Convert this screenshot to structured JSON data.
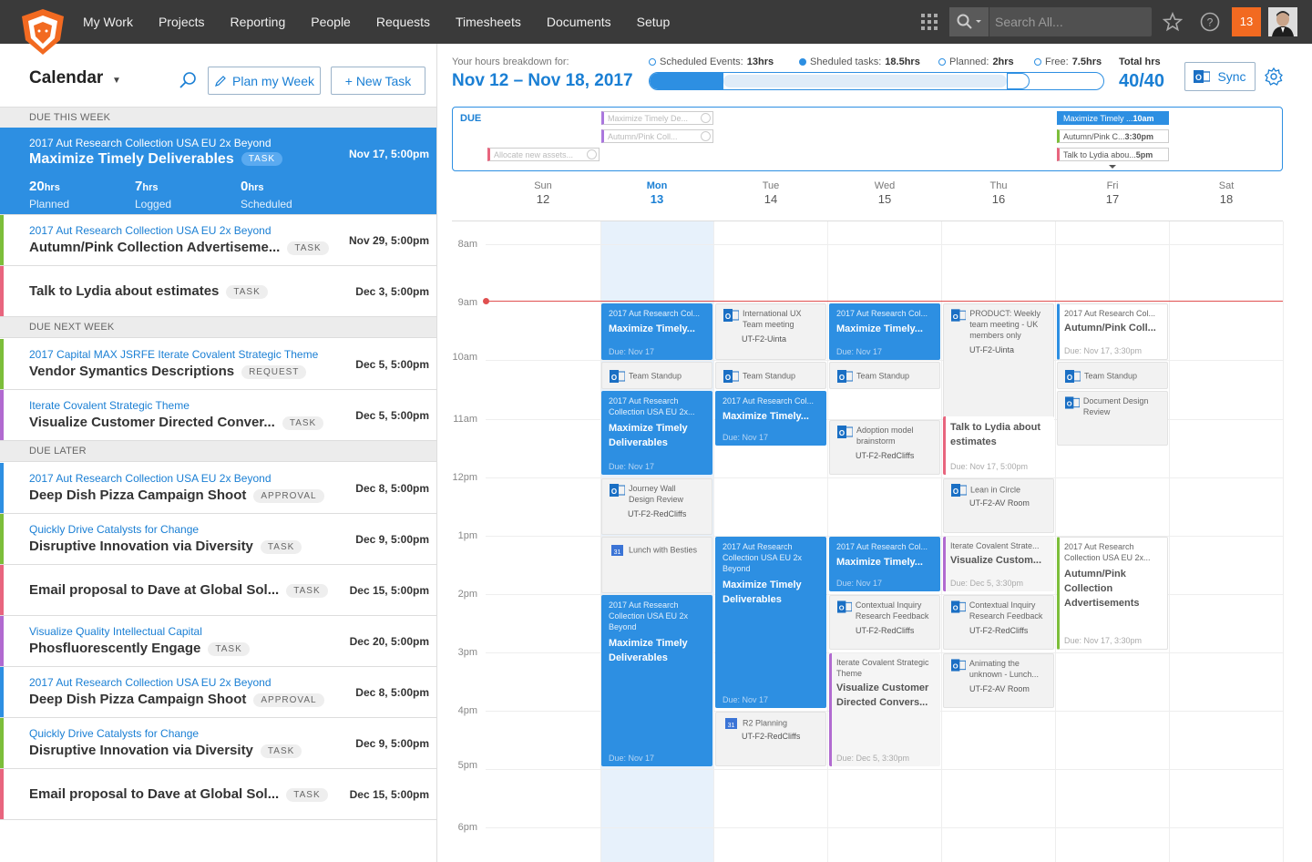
{
  "nav": {
    "items": [
      "My Work",
      "Projects",
      "Reporting",
      "People",
      "Requests",
      "Timesheets",
      "Documents",
      "Setup"
    ],
    "search_placeholder": "Search All...",
    "notifications": "13"
  },
  "left": {
    "title": "Calendar",
    "plan_label": "Plan my Week",
    "new_task_label": "+ New Task",
    "sections": {
      "this_week": "DUE THIS WEEK",
      "next_week": "DUE NEXT WEEK",
      "later": "DUE LATER"
    },
    "active": {
      "project": "2017 Aut Research Collection USA EU 2x Beyond",
      "name": "Maximize Timely Deliverables",
      "badge": "TASK",
      "due": "Nov 17, 5:00pm",
      "stats": [
        {
          "v": "20",
          "u": "hrs",
          "l": "Planned"
        },
        {
          "v": "7",
          "u": "hrs",
          "l": "Logged"
        },
        {
          "v": "0",
          "u": "hrs",
          "l": "Scheduled"
        }
      ]
    },
    "tasks": [
      {
        "project": "2017 Aut Research Collection USA EU 2x Beyond",
        "name": "Autumn/Pink Collection Advertiseme...",
        "badge": "TASK",
        "due": "Nov 29, 5:00pm",
        "color": "#7cbe3a"
      },
      {
        "project": "",
        "name": "Talk to Lydia about estimates",
        "badge": "TASK",
        "due": "Dec 3, 5:00pm",
        "color": "#e8657e"
      },
      {
        "project": "2017 Capital MAX JSRFE Iterate Covalent Strategic Theme",
        "name": "Vendor Symantics Descriptions",
        "badge": "REQUEST",
        "due": "Dec 5, 5:00pm",
        "color": "#7cbe3a"
      },
      {
        "project": "Iterate Covalent Strategic Theme",
        "name": "Visualize Customer Directed Conver...",
        "badge": "TASK",
        "due": "Dec 5, 5:00pm",
        "color": "#b16ad0"
      },
      {
        "project": "2017 Aut Research Collection USA EU 2x Beyond",
        "name": "Deep Dish Pizza Campaign Shoot",
        "badge": "APPROVAL",
        "due": "Dec 8, 5:00pm",
        "color": "#2d8fe2"
      },
      {
        "project": "Quickly Drive Catalysts for Change",
        "name": "Disruptive Innovation via Diversity",
        "badge": "TASK",
        "due": "Dec 9, 5:00pm",
        "color": "#7cbe3a"
      },
      {
        "project": "",
        "name": "Email proposal to Dave at Global Sol...",
        "badge": "TASK",
        "due": "Dec 15, 5:00pm",
        "color": "#e8657e"
      },
      {
        "project": "Visualize Quality Intellectual Capital",
        "name": "Phosfluorescently Engage",
        "badge": "TASK",
        "due": "Dec 20, 5:00pm",
        "color": "#b16ad0"
      },
      {
        "project": "2017 Aut Research Collection USA EU 2x Beyond",
        "name": "Deep Dish Pizza Campaign Shoot",
        "badge": "APPROVAL",
        "due": "Dec 8, 5:00pm",
        "color": "#2d8fe2"
      },
      {
        "project": "Quickly Drive Catalysts for Change",
        "name": "Disruptive Innovation via Diversity",
        "badge": "TASK",
        "due": "Dec 9, 5:00pm",
        "color": "#7cbe3a"
      },
      {
        "project": "",
        "name": "Email proposal to Dave at Global Sol...",
        "badge": "TASK",
        "due": "Dec 15, 5:00pm",
        "color": "#e8657e"
      }
    ]
  },
  "hours": {
    "label": "Your hours breakdown for:",
    "range": "Nov 12 – Nov 18, 2017",
    "legend": [
      {
        "l": "Scheduled Events:",
        "v": "13hrs"
      },
      {
        "l": "Sheduled tasks:",
        "v": "18.5hrs"
      },
      {
        "l": "Planned:",
        "v": "2hrs"
      },
      {
        "l": "Free:",
        "v": "7.5hrs"
      }
    ],
    "total_label": "Total hrs",
    "total": "40/40",
    "sync_label": "Sync",
    "fractions": {
      "events": 0.325,
      "tasks": 0.4625,
      "planned": 0.05
    }
  },
  "due_label": "DUE",
  "due_chips": {
    "mon": [
      {
        "text": "Maximize Timely De...",
        "done": true
      },
      {
        "text": "Autumn/Pink Coll...",
        "done": true
      }
    ],
    "sun": [
      {
        "text": "Allocate new assets...",
        "done": true
      }
    ],
    "fri": [
      {
        "text": "Maximize Timely ...",
        "time": "10am"
      },
      {
        "text": "Autumn/Pink C...",
        "time": "3:30pm"
      },
      {
        "text": "Talk to Lydia abou...",
        "time": "5pm"
      }
    ]
  },
  "days": [
    {
      "d": "Sun",
      "n": "12"
    },
    {
      "d": "Mon",
      "n": "13"
    },
    {
      "d": "Tue",
      "n": "14"
    },
    {
      "d": "Wed",
      "n": "15"
    },
    {
      "d": "Thu",
      "n": "16"
    },
    {
      "d": "Fri",
      "n": "17"
    },
    {
      "d": "Sat",
      "n": "18"
    }
  ],
  "hours_labels": [
    "8am",
    "9am",
    "10am",
    "11am",
    "12pm",
    "1pm",
    "2pm",
    "3pm",
    "4pm",
    "5pm",
    "6pm"
  ],
  "events": {
    "mon1": {
      "p": "2017 Aut Research Col...",
      "t": "Maximize Timely...",
      "d": "Due: Nov 17"
    },
    "mon2": {
      "t": "Team Standup"
    },
    "mon3": {
      "p": "2017 Aut Research Collection USA EU 2x...",
      "t": "Maximize Timely Deliverables",
      "d": "Due: Nov 17"
    },
    "mon4": {
      "t": "Journey Wall Design Review",
      "r": "UT-F2-RedCliffs"
    },
    "mon5": {
      "t": "Lunch with Besties"
    },
    "mon6": {
      "p": "2017 Aut Research Collection USA EU 2x Beyond",
      "t": "Maximize Timely Deliverables",
      "d": "Due: Nov 17"
    },
    "tue1": {
      "t": "International UX Team meeting",
      "r": "UT-F2-Uinta"
    },
    "tue2": {
      "t": "Team Standup"
    },
    "tue3": {
      "p": "2017 Aut Research Col...",
      "t": "Maximize Timely...",
      "d": "Due: Nov 17"
    },
    "tue4": {
      "p": "2017 Aut Research Collection USA EU 2x Beyond",
      "t": "Maximize Timely Deliverables",
      "d": "Due: Nov 17"
    },
    "tue5": {
      "t": "R2 Planning",
      "r": "UT-F2-RedCliffs"
    },
    "wed1": {
      "p": "2017 Aut Research Col...",
      "t": "Maximize Timely...",
      "d": "Due: Nov 17"
    },
    "wed2": {
      "t": "Team Standup"
    },
    "wed3": {
      "t": "Adoption model brainstorm",
      "r": "UT-F2-RedCliffs"
    },
    "wed4": {
      "p": "2017 Aut Research Col...",
      "t": "Maximize Timely...",
      "d": "Due: Nov 17"
    },
    "wed5": {
      "t": "Contextual Inquiry Research Feedback",
      "r": "UT-F2-RedCliffs"
    },
    "wed6": {
      "p": "Iterate Covalent Strategic Theme",
      "t": "Visualize Customer Directed Convers...",
      "d": "Due: Dec 5, 3:30pm"
    },
    "thu1": {
      "t": "PRODUCT: Weekly team meeting - UK members only",
      "r": "UT-F2-Uinta"
    },
    "thu2": {
      "t": "Talk to Lydia about estimates",
      "d": "Due: Nov 17, 5:00pm"
    },
    "thu3": {
      "t": "Lean in Circle",
      "r": "UT-F2-AV Room"
    },
    "thu4": {
      "p": "Iterate Covalent Strate...",
      "t": "Visualize Custom...",
      "d": "Due: Dec 5, 3:30pm"
    },
    "thu5": {
      "t": "Contextual Inquiry Research Feedback",
      "r": "UT-F2-RedCliffs"
    },
    "thu6": {
      "t": "Animating the unknown - Lunch...",
      "r": "UT-F2-AV Room"
    },
    "fri1": {
      "p": "2017 Aut Research Col...",
      "t": "Autumn/Pink Coll...",
      "d": "Due: Nov 17, 3:30pm"
    },
    "fri2": {
      "t": "Team Standup"
    },
    "fri3": {
      "t": "Document Design Review"
    },
    "fri4": {
      "p": "2017 Aut Research Collection USA EU 2x...",
      "t": "Autumn/Pink Collection Advertisements",
      "d": "Due: Nov 17, 3:30pm"
    }
  }
}
